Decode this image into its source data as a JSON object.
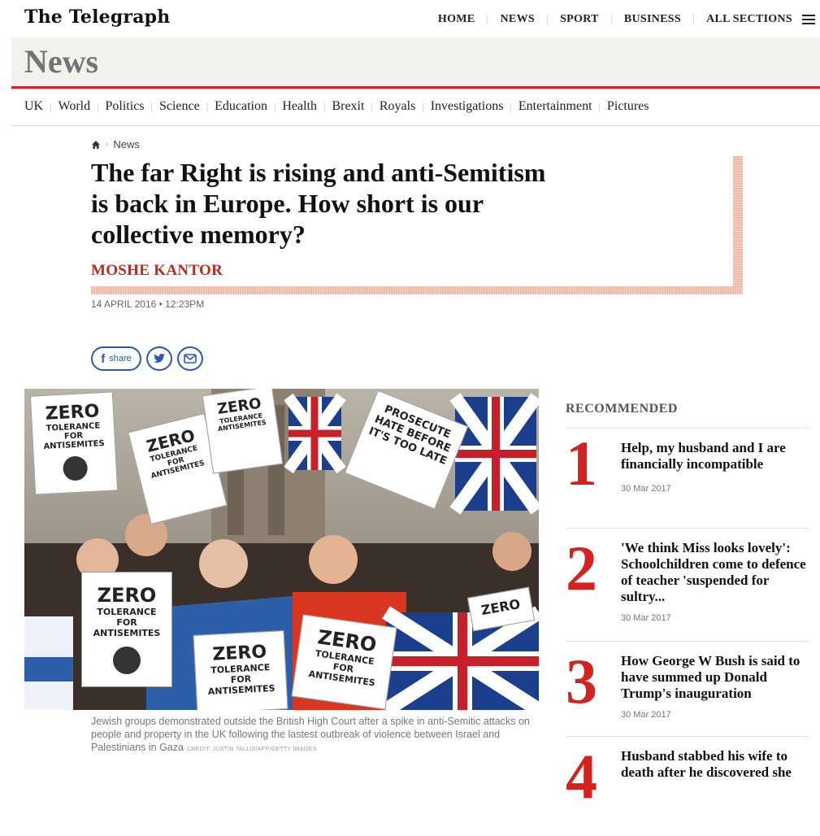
{
  "site": {
    "logo": "The Telegraph",
    "nav": [
      "HOME",
      "NEWS",
      "SPORT",
      "BUSINESS",
      "ALL SECTIONS"
    ],
    "section": "News",
    "subnav": [
      "UK",
      "World",
      "Politics",
      "Science",
      "Education",
      "Health",
      "Brexit",
      "Royals",
      "Investigations",
      "Entertainment",
      "Pictures"
    ]
  },
  "article": {
    "breadcrumb": "News",
    "headline": "The far Right is rising and anti-Semitism is back in Europe. How short is our collective memory?",
    "author": "MOSHE KANTOR",
    "date": "14 APRIL 2016 • 12:23PM",
    "share_label": "share",
    "caption": "Jewish groups demonstrated outside the British High Court after a spike in anti-Semitic attacks on people and property in the UK following the lastest outbreak of violence between Israel and Palestinians in Gaza",
    "credit": "CREDIT: JUSTIN TALLIS/AFP/GETTY IMAGES",
    "placards": {
      "zero": "ZERO",
      "tolerance": "TOLERANCE",
      "for": "FOR",
      "antisemites": "ANTISEMITES",
      "prosecute": "PROSECUTE HATE BEFORE IT'S TOO LATE"
    }
  },
  "recommended": {
    "title": "RECOMMENDED",
    "items": [
      {
        "num": "1",
        "headline": "Help, my husband and I are financially incompatible",
        "date": "30 Mar 2017"
      },
      {
        "num": "2",
        "headline": "'We think Miss looks lovely': Schoolchildren come to defence of teacher 'suspended for sultry...",
        "date": "30 Mar 2017"
      },
      {
        "num": "3",
        "headline": "How George W Bush is said to have summed up Donald Trump's inauguration",
        "date": "30 Mar 2017"
      },
      {
        "num": "4",
        "headline": "Husband stabbed his wife to death after he discovered she",
        "date": ""
      }
    ]
  },
  "icons": [
    "home-icon",
    "hamburger-icon",
    "facebook-icon",
    "twitter-icon",
    "email-icon"
  ],
  "colors": {
    "accent_red": "#d5221e",
    "byline_red": "#c9251d",
    "share_blue": "#2a5aa8",
    "top_strip_blue": "#2a7fbd"
  }
}
